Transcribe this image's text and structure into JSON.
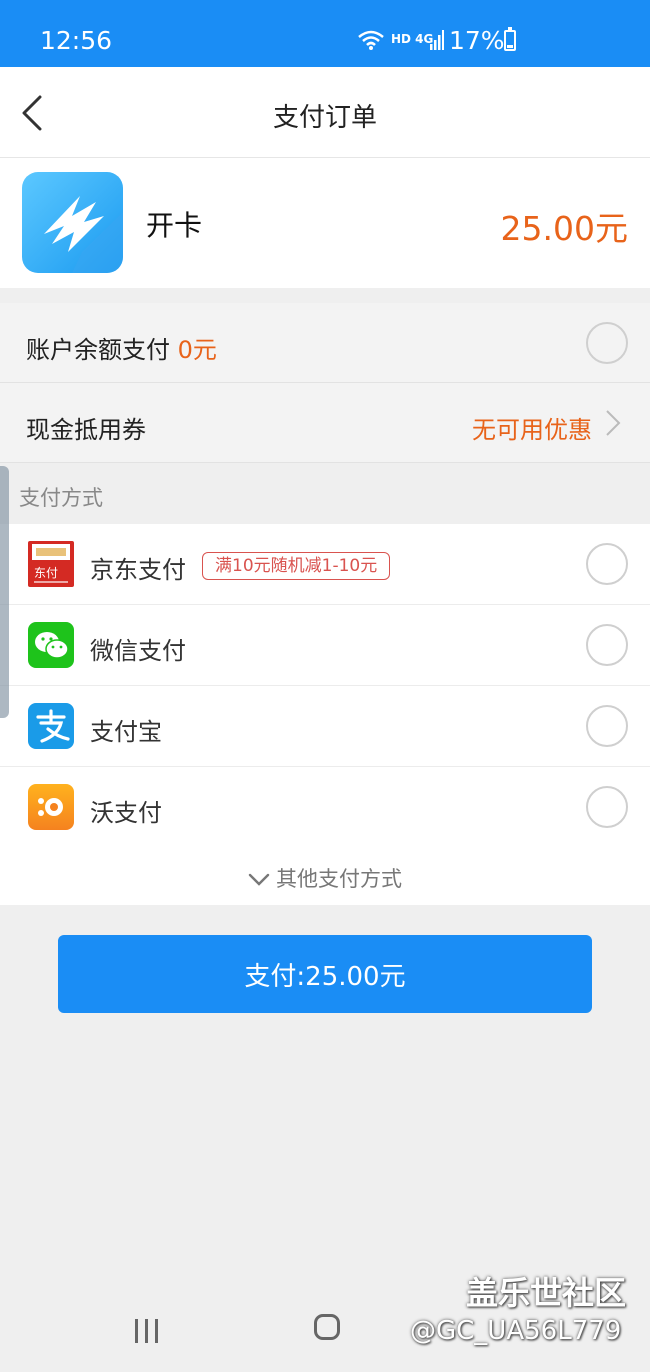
{
  "status_bar": {
    "time": "12:56",
    "network": "HD 4G",
    "battery_text": "17%",
    "battery_level": 0.17
  },
  "header": {
    "title": "支付订单"
  },
  "order": {
    "name": "开卡",
    "price": "25.00元"
  },
  "balance": {
    "label": "账户余额支付",
    "amount": "0元"
  },
  "coupon": {
    "label": "现金抵用券",
    "value": "无可用优惠"
  },
  "payment_section": {
    "title": "支付方式"
  },
  "payment_methods": [
    {
      "label": "京东支付",
      "icon": "jd-pay-icon",
      "promo": "满10元随机减1-10元"
    },
    {
      "label": "微信支付",
      "icon": "wechat-pay-icon"
    },
    {
      "label": "支付宝",
      "icon": "alipay-icon"
    },
    {
      "label": "沃支付",
      "icon": "wo-pay-icon"
    }
  ],
  "more_methods": {
    "label": "其他支付方式"
  },
  "pay_button": {
    "label": "支付:25.00元"
  },
  "watermark": {
    "line1": "盖乐世社区",
    "line2": "@GC_UA56L779"
  },
  "colors": {
    "primary": "#1a8df5",
    "accent": "#e8631a",
    "promo": "#d9534f"
  }
}
